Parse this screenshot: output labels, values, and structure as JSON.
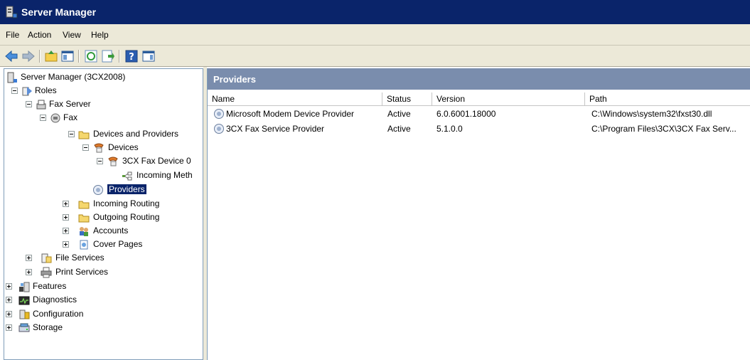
{
  "window": {
    "title": "Server Manager"
  },
  "menu": {
    "items": [
      "File",
      "Action",
      "View",
      "Help"
    ]
  },
  "toolbar": {
    "buttons": [
      "back-arrow-icon",
      "forward-arrow-icon",
      "up-folder-icon",
      "show-hide-tree-icon",
      "refresh-icon",
      "export-list-icon",
      "help-icon",
      "action-pane-icon"
    ]
  },
  "tree": {
    "root": "Server Manager (3CX2008)",
    "roles": "Roles",
    "fax_server": "Fax Server",
    "fax": "Fax",
    "devices_and_providers": "Devices and Providers",
    "devices": "Devices",
    "device0": "3CX Fax Device 0",
    "incoming_method": "Incoming Meth",
    "providers": "Providers",
    "incoming_routing": "Incoming Routing",
    "outgoing_routing": "Outgoing Routing",
    "accounts": "Accounts",
    "cover_pages": "Cover Pages",
    "file_services": "File Services",
    "print_services": "Print Services",
    "features": "Features",
    "diagnostics": "Diagnostics",
    "configuration": "Configuration",
    "storage": "Storage"
  },
  "panel": {
    "title": "Providers",
    "columns": {
      "name": "Name",
      "status": "Status",
      "version": "Version",
      "path": "Path"
    },
    "rows": [
      {
        "name": "Microsoft Modem Device Provider",
        "status": "Active",
        "version": "6.0.6001.18000",
        "path": "C:\\Windows\\system32\\fxst30.dll"
      },
      {
        "name": "3CX Fax Service Provider",
        "status": "Active",
        "version": "5.1.0.0",
        "path": "C:\\Program Files\\3CX\\3CX Fax Serv..."
      }
    ]
  },
  "colors": {
    "title_bar": "#0a246a",
    "panel_header": "#7a8dad",
    "selection": "#0a246a",
    "chrome": "#ece9d8"
  }
}
